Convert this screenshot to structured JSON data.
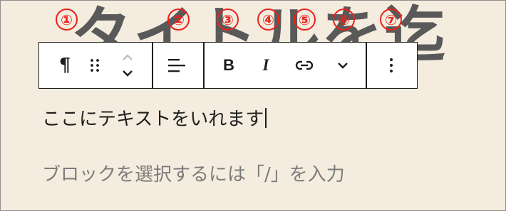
{
  "background_heading": "タイトルを迄",
  "markers": [
    "①",
    "②",
    "③",
    "④",
    "⑤",
    "⑥",
    "⑦"
  ],
  "toolbar": {
    "block_type_icon": "pilcrow-icon",
    "drag_icon": "drag-handle-icon",
    "move_up_icon": "chevron-up-icon",
    "move_down_icon": "chevron-down-icon",
    "align_icon": "align-left-icon",
    "bold_label": "B",
    "italic_label": "I",
    "link_icon": "link-icon",
    "more_formats_icon": "chevron-down-icon",
    "options_icon": "more-vertical-icon"
  },
  "editor": {
    "paragraph_text": "ここにテキストをいれます",
    "placeholder": "ブロックを選択するには「/」を入力"
  },
  "colors": {
    "background": "#f4ecde",
    "marker": "#e8231d",
    "toolbar_border": "#1e1e1e",
    "placeholder": "#7c7c7c"
  }
}
